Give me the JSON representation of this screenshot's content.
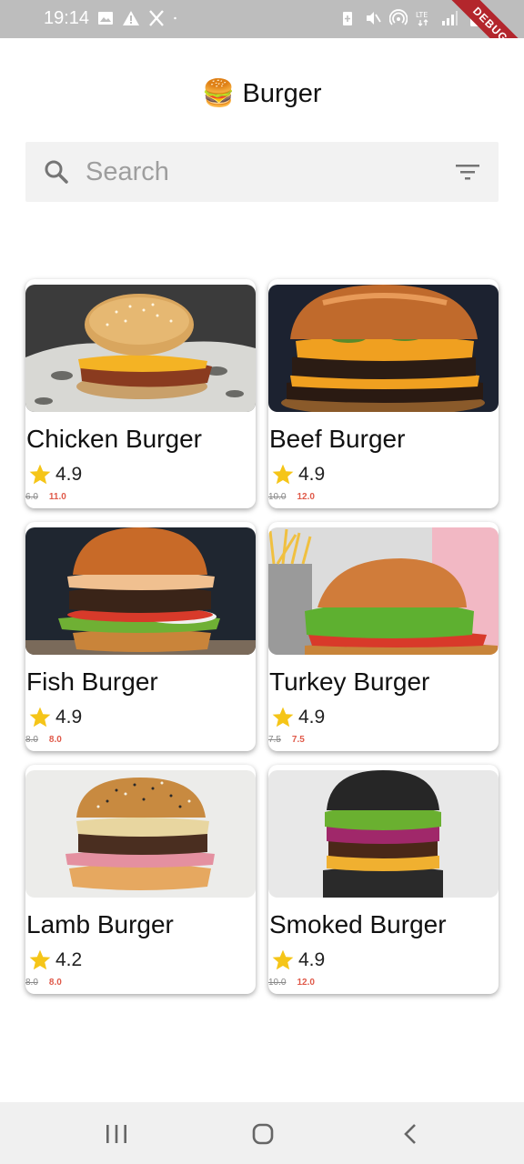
{
  "status_bar": {
    "time": "19:14",
    "debug_label": "DEBUG",
    "left_icons": [
      "image-icon",
      "warning-icon",
      "x-icon",
      "dot-icon"
    ],
    "right_icons": [
      "battery-saver-icon",
      "mute-icon",
      "hotspot-icon",
      "lte-icon",
      "signal-icon",
      "battery-icon"
    ]
  },
  "header": {
    "emoji": "🍔",
    "title": "Burger"
  },
  "search": {
    "placeholder": "Search"
  },
  "products": [
    {
      "name": "Chicken Burger",
      "rating": "4.9",
      "old_price": "6.0",
      "price": "11.0",
      "image": "chicken-burger-image"
    },
    {
      "name": "Beef Burger",
      "rating": "4.9",
      "old_price": "10.0",
      "price": "12.0",
      "image": "beef-burger-image"
    },
    {
      "name": "Fish Burger",
      "rating": "4.9",
      "old_price": "8.0",
      "price": "8.0",
      "image": "fish-burger-image"
    },
    {
      "name": "Turkey Burger",
      "rating": "4.9",
      "old_price": "7.5",
      "price": "7.5",
      "image": "turkey-burger-image"
    },
    {
      "name": "Lamb Burger",
      "rating": "4.2",
      "old_price": "8.0",
      "price": "8.0",
      "image": "lamb-burger-image"
    },
    {
      "name": "Smoked Burger",
      "rating": "4.9",
      "old_price": "10.0",
      "price": "12.0",
      "image": "smoked-burger-image"
    }
  ],
  "colors": {
    "status_bar": "#bdbdbd",
    "search_bg": "#f2f2f2",
    "star": "#f5c518",
    "price": "#e05a4a",
    "debug": "#b3262c"
  },
  "nav_bar": {
    "buttons": [
      "recents-icon",
      "home-icon",
      "back-icon"
    ]
  }
}
